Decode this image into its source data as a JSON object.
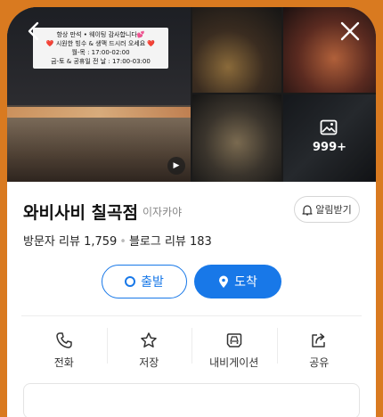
{
  "photos": {
    "notice_lines": [
      "항상 만석 • 웨이팅 감사합니다💕",
      "❤️ 시원한 빙수 & 생맥 드시러 오세요 ❤️",
      "월-목 : 17:00-02:00",
      "금-토 & 공휴일 전 날 : 17:00-03:00"
    ],
    "more_count": "999+",
    "play_icon": "play-icon",
    "more_icon": "image-icon"
  },
  "place": {
    "name": "와비사비 칠곡점",
    "category": "이자카야",
    "alert_label": "알림받기",
    "visitor_reviews": "방문자 리뷰 1,759",
    "blog_reviews": "블로그 리뷰 183",
    "dot": "•"
  },
  "route": {
    "depart_label": "출발",
    "arrive_label": "도착"
  },
  "actions": [
    {
      "label": "전화",
      "icon": "phone-icon"
    },
    {
      "label": "저장",
      "icon": "star-icon"
    },
    {
      "label": "내비게이션",
      "icon": "car-icon"
    },
    {
      "label": "공유",
      "icon": "share-icon"
    }
  ],
  "colors": {
    "accent": "#1878e8",
    "frame": "#d97a20"
  }
}
